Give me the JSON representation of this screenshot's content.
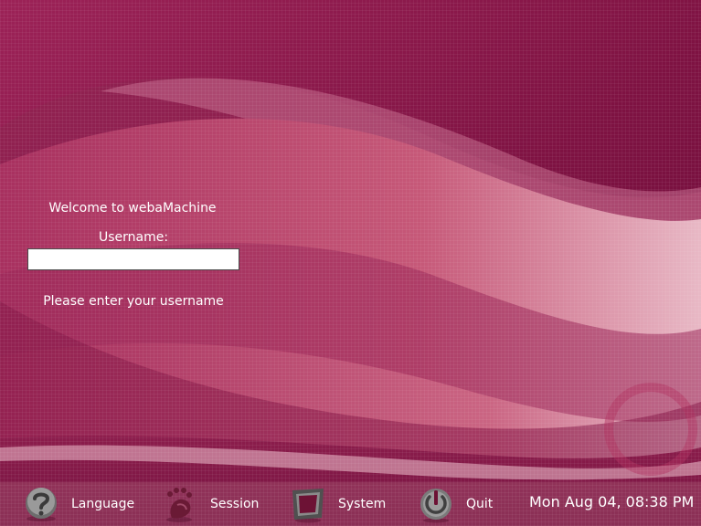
{
  "login": {
    "welcome": "Welcome to webaMachine",
    "username_label": "Username:",
    "username_value": "",
    "message": "Please enter your username"
  },
  "bottom_bar": {
    "language_label": "Language",
    "session_label": "Session",
    "system_label": "System",
    "quit_label": "Quit",
    "clock": "Mon Aug 04, 08:38 PM"
  },
  "colors": {
    "background": "#8a1a49",
    "text": "#ffffff"
  },
  "icons": [
    "question-icon",
    "gimp-footprint-icon",
    "monitor-icon",
    "power-icon"
  ]
}
